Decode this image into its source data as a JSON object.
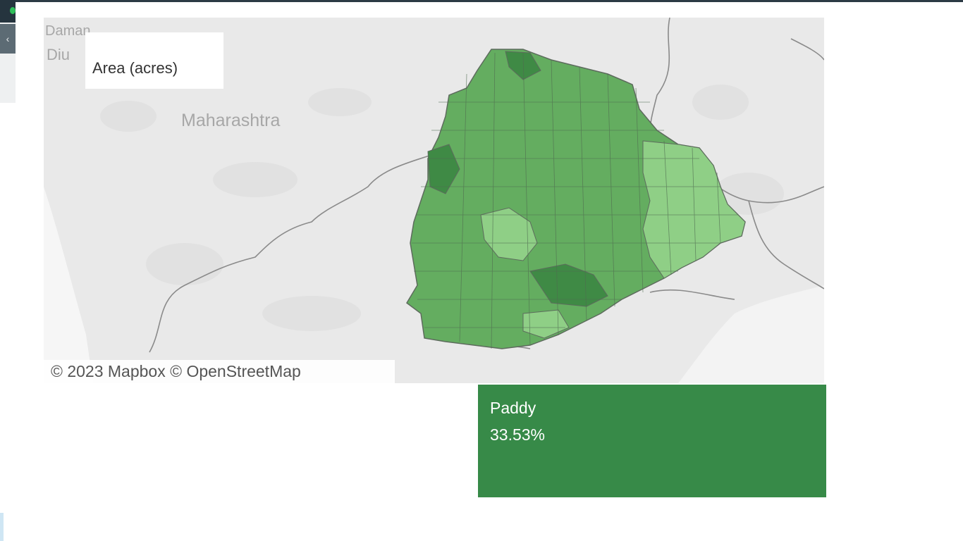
{
  "legend": {
    "title": "Area (acres)"
  },
  "map": {
    "places": [
      {
        "name": "Maharashtra"
      },
      {
        "name": "Daman"
      },
      {
        "name": "Diu"
      }
    ],
    "attribution": "© 2023 Mapbox  © OpenStreetMap",
    "colors": {
      "background": "#e9e9e9",
      "land": "#e3e3e3",
      "border": "#8a8a8a",
      "region_light": "#8fcf86",
      "region_mid": "#64ad60",
      "region_dark": "#3f8a45",
      "region_outline": "#5d6b5d"
    }
  },
  "tooltip": {
    "crop": "Paddy",
    "percent": "33.53%",
    "color": "#378a48"
  }
}
